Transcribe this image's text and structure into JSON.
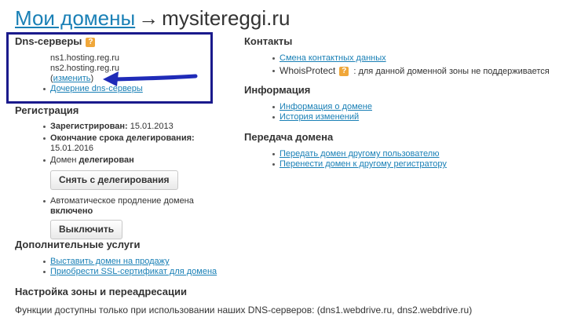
{
  "page": {
    "breadcrumb": "Мои домены",
    "arrow": "→",
    "domain": "mysitereggi.ru"
  },
  "dns": {
    "title": "Dns-серверы",
    "help": "?",
    "ns1": "ns1.hosting.reg.ru",
    "ns2": "ns2.hosting.reg.ru",
    "paren_open": "(",
    "change_link": "изменить",
    "paren_close": ")",
    "child_link": "Дочерние dns-серверы"
  },
  "registration": {
    "title": "Регистрация",
    "registered_label": "Зарегистрирован:",
    "registered_value": "15.01.2013",
    "delegation_end_label": "Окончание срока делегирования:",
    "delegation_end_value": "15.01.2016",
    "domain_word": "Домен",
    "domain_status": "делегирован",
    "undelegate_button": "Снять с делегирования",
    "autorenew_text": "Автоматическое продление домена",
    "autorenew_status": "включено",
    "disable_button": "Выключить"
  },
  "extra": {
    "title": "Дополнительные услуги",
    "links": [
      "Выставить домен на продажу",
      "Приобрести SSL-сертификат для домена"
    ]
  },
  "zone": {
    "title": "Настройка зоны и переадресации",
    "text": "Функции доступны только при использовании наших DNS-серверов: (dns1.webdrive.ru, dns2.webdrive.ru)"
  },
  "contacts": {
    "title": "Контакты",
    "change_link": "Смена контактных данных",
    "whois_label": "WhoisProtect",
    "help": "?",
    "whois_text": ": для данной доменной зоны не поддерживается"
  },
  "info": {
    "title": "Информация",
    "links": [
      "Информация о домене",
      "История изменений"
    ]
  },
  "transfer": {
    "title": "Передача домена",
    "links": [
      "Передать домен другому пользователю",
      "Перенести домен к другому регистратору"
    ]
  },
  "colors": {
    "link": "#1a80b6",
    "highlight_box": "#1a1a8c",
    "annotation_arrow": "#1f2bb8",
    "help_icon": "#f0a73a"
  },
  "icons": {
    "help": "question-mark-icon",
    "annotation": "arrow-left-icon"
  }
}
